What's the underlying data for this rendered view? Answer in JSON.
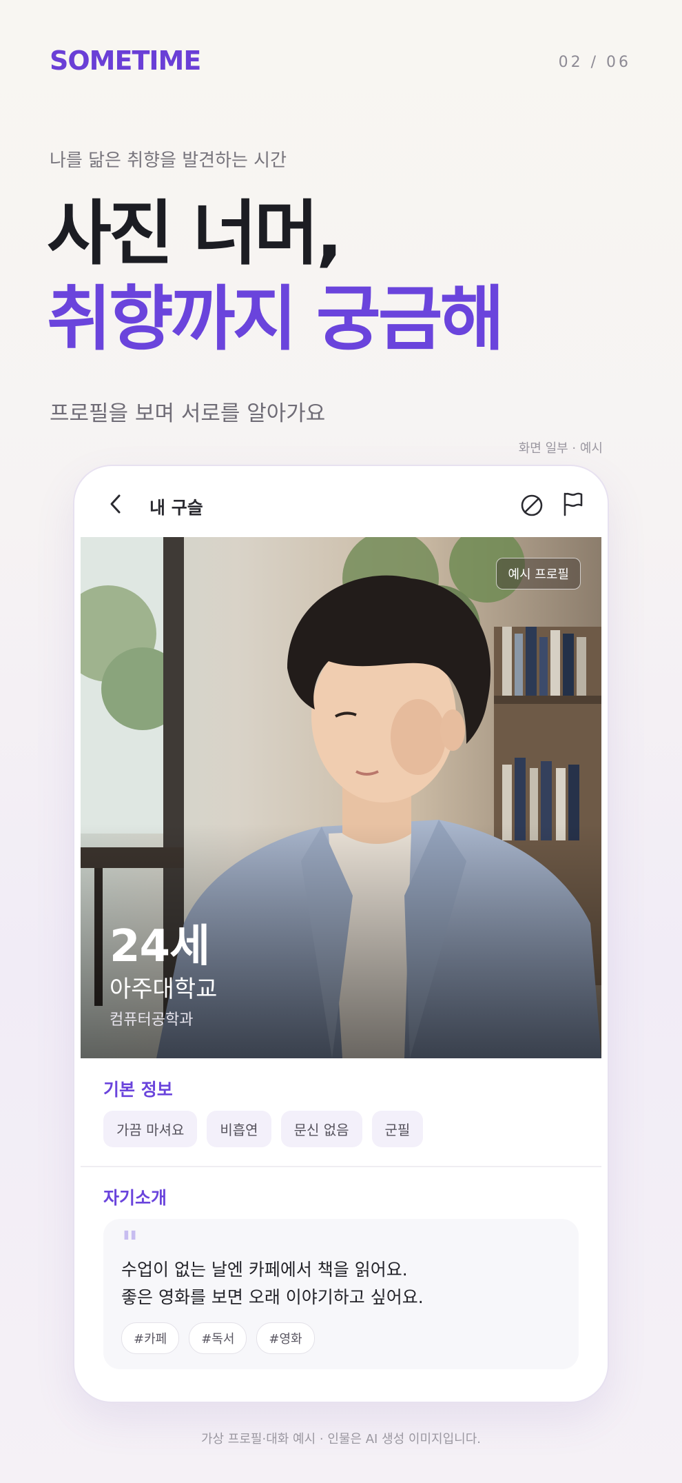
{
  "brand": "SOMETIME",
  "page_counter": "02 / 06",
  "eyebrow": "나를 닮은 취향을 발견하는 시간",
  "headline": {
    "line1": "사진 너머,",
    "line2": "취향까지 궁금해"
  },
  "subline": "프로필을 보며 서로를 알아가요",
  "screen_note": "화면 일부 · 예시",
  "phone": {
    "topbar": {
      "title": "내 구슬",
      "back_icon": "chevron-left",
      "block_icon": "block-circle",
      "report_icon": "flag"
    },
    "photo": {
      "sample_tag": "예시 프로필",
      "age": "24세",
      "school": "아주대학교",
      "major": "컴퓨터공학과"
    },
    "basic_info": {
      "title": "기본 정보",
      "chips": [
        "가끔 마셔요",
        "비흡연",
        "문신 없음",
        "군필"
      ]
    },
    "intro": {
      "title": "자기소개",
      "line1": "수업이 없는 날엔 카페에서 책을 읽어요.",
      "line2": "좋은 영화를 보면 오래 이야기하고 싶어요.",
      "hashtags": [
        "#카페",
        "#독서",
        "#영화"
      ]
    }
  },
  "footer_note": "가상 프로필·대화 예시 · 인물은 AI 생성 이미지입니다.",
  "colors": {
    "accent": "#6a44dc",
    "chip_bg": "#f3f0fa",
    "text_dark": "#1c1d23"
  }
}
